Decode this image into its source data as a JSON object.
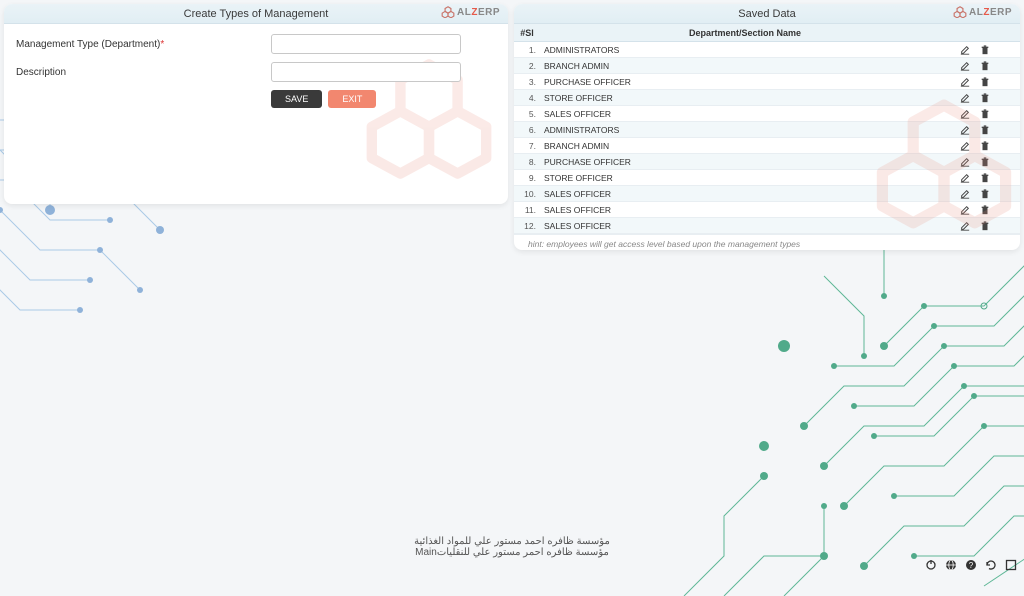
{
  "brand": {
    "text_a": "AL",
    "text_z": "Z",
    "text_erp": "ERP"
  },
  "leftPanel": {
    "title": "Create Types of Management",
    "field1_label": "Management Type (Department)",
    "field1_required": "*",
    "field2_label": "Description",
    "save_label": "SAVE",
    "exit_label": "EXIT"
  },
  "rightPanel": {
    "title": "Saved Data",
    "col_sl": "#Sl",
    "col_name": "Department/Section Name",
    "rows": [
      {
        "sl": "1.",
        "name": "ADMINISTRATORS"
      },
      {
        "sl": "2.",
        "name": "BRANCH ADMIN"
      },
      {
        "sl": "3.",
        "name": "PURCHASE OFFICER"
      },
      {
        "sl": "4.",
        "name": "STORE OFFICER"
      },
      {
        "sl": "5.",
        "name": "SALES OFFICER"
      },
      {
        "sl": "6.",
        "name": "ADMINISTRATORS"
      },
      {
        "sl": "7.",
        "name": "BRANCH ADMIN"
      },
      {
        "sl": "8.",
        "name": "PURCHASE OFFICER"
      },
      {
        "sl": "9.",
        "name": "STORE OFFICER"
      },
      {
        "sl": "10.",
        "name": "SALES OFFICER"
      },
      {
        "sl": "11.",
        "name": "SALES OFFICER"
      },
      {
        "sl": "12.",
        "name": "SALES OFFICER"
      }
    ],
    "hint": "hint: employees will get access level based upon the management types"
  },
  "footer": {
    "line1": "مؤسسة ظافره احمد مستور علي للمواد الغذائية",
    "line2": "مؤسسة ظافره احمر مستور علي للنقلياتMain"
  }
}
